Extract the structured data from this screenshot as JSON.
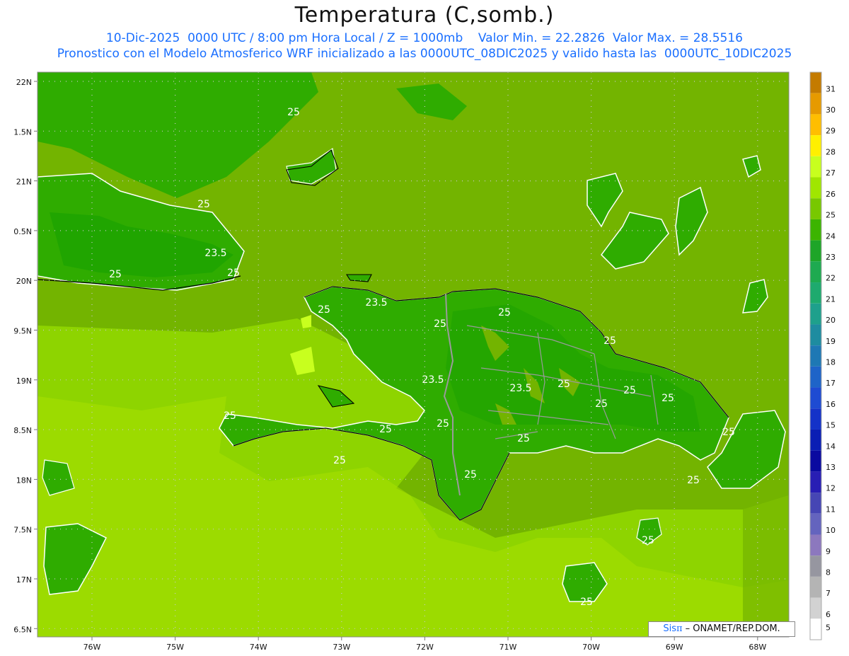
{
  "header": {
    "title": "Temperatura (C,somb.)",
    "line1": "10-Dic-2025  0000 UTC / 8:00 pm Hora Local / Z = 1000mb    Valor Min. = 22.2826  Valor Max. = 28.5516",
    "line2": "Pronostico con el Modelo Atmosferico WRF inicializado a las 0000UTC_08DIC2025 y valido hasta las  0000UTC_10DIC2025"
  },
  "map": {
    "lat_labels": [
      "22N",
      "1.5N",
      "21N",
      "0.5N",
      "20N",
      "9.5N",
      "19N",
      "8.5N",
      "18N",
      "7.5N",
      "17N",
      "6.5N"
    ],
    "lon_labels": [
      "76W",
      "75W",
      "74W",
      "73W",
      "72W",
      "71W",
      "70W",
      "69W",
      "68W"
    ],
    "contour_labels": [
      "25",
      "25",
      "23.5",
      "25",
      "25",
      "23.5",
      "25",
      "25",
      "25",
      "25",
      "23.5",
      "23.5",
      "25",
      "25",
      "25",
      "25",
      "25",
      "25",
      "25",
      "25",
      "25",
      "25",
      "25",
      "25",
      "25",
      "25"
    ],
    "colors": {
      "sea": "#73b400",
      "light": "#8ed400",
      "lighter": "#a8e000",
      "dark": "#2fac00",
      "darker": "#18a000",
      "coast": "#000000",
      "border": "#9a9a9a",
      "contour": "#ffffff",
      "grid": "#c8c8c8"
    }
  },
  "colorbar": {
    "labels": [
      "31",
      "30",
      "29",
      "28",
      "27",
      "26",
      "25",
      "24",
      "23",
      "22",
      "21",
      "20",
      "19",
      "18",
      "17",
      "16",
      "15",
      "14",
      "13",
      "12",
      "11",
      "10",
      "9",
      "8",
      "7",
      "6",
      "5"
    ],
    "colors": [
      "#c47b00",
      "#e69a00",
      "#ffbe00",
      "#fff000",
      "#c8ff1e",
      "#a0e600",
      "#78c800",
      "#3cb400",
      "#1ea528",
      "#1eaa50",
      "#1eaa6e",
      "#1ea08c",
      "#1e8ca0",
      "#1e78b4",
      "#1e64c8",
      "#1e4bd2",
      "#1432c8",
      "#0a1eb4",
      "#0a0aa0",
      "#281eb4",
      "#4646b4",
      "#6464be",
      "#8c78be",
      "#9696a0",
      "#b4b4b4",
      "#d2d2d2",
      "#ffffff"
    ]
  },
  "badge": {
    "brand_sis": "Sis",
    "brand_pi": "π",
    "credit": " – ONAMET/REP.DOM."
  }
}
